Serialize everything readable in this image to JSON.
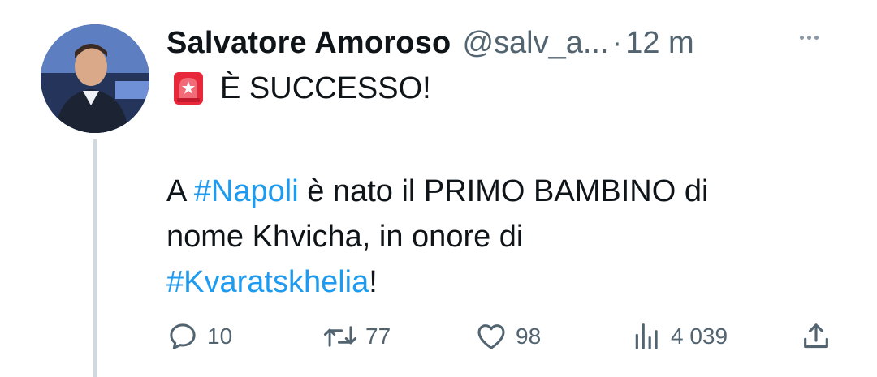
{
  "tweet": {
    "author_name": "Salvatore Amoroso",
    "handle": "@salv_a...",
    "separator": "·",
    "time": "12 m",
    "line1": "È SUCCESSO!",
    "body_prefix": "A ",
    "hashtag1": "#Napoli",
    "body_mid1": " è nato il PRIMO BAMBINO di",
    "body_line2": "nome Khvicha, in onore di",
    "hashtag2": "#Kvaratskhelia",
    "body_suffix": "!"
  },
  "actions": {
    "replies": "10",
    "retweets": "77",
    "likes": "98",
    "views": "4 039"
  },
  "icons": {
    "alert": "rotating-light-icon",
    "reply": "reply-icon",
    "retweet": "retweet-icon",
    "like": "heart-icon",
    "views": "views-icon",
    "share": "share-icon",
    "more": "more-icon"
  },
  "colors": {
    "text": "#0f1419",
    "secondary": "#536471",
    "hashtag": "#1d9bf0",
    "thread_line": "#cfd9de"
  }
}
